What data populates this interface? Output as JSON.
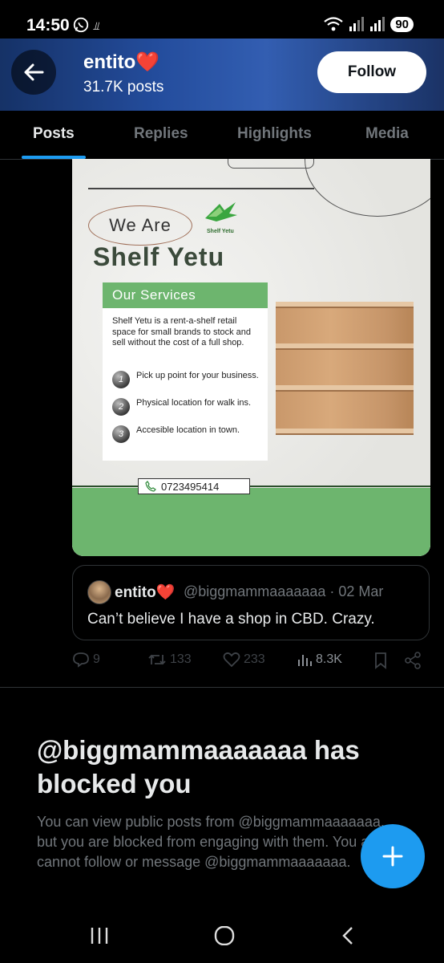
{
  "status_bar": {
    "time": "14:50",
    "vibrate_glyph": "⫫",
    "battery": "90",
    "icons": [
      "whatsapp-icon",
      "vibrate-icon",
      "wifi-icon",
      "signal-icon",
      "signal-icon-2",
      "battery-icon"
    ]
  },
  "header": {
    "title": "entito",
    "title_emoji": "❤️",
    "subtitle": "31.7K posts",
    "follow_label": "Follow",
    "back_icon": "arrow-left-icon"
  },
  "tabs": [
    {
      "label": "Posts",
      "active": true
    },
    {
      "label": "Replies",
      "active": false
    },
    {
      "label": "Highlights",
      "active": false
    },
    {
      "label": "Media",
      "active": false
    }
  ],
  "post_image": {
    "we_are": "We Are",
    "brand": "Shelf Yetu",
    "logo_text": "Shelf Yetu",
    "services_heading": "Our Services",
    "services_desc": "Shelf Yetu is a rent-a-shelf retail space for small brands to stock and sell without the cost of a full shop.",
    "services": [
      {
        "num": "1",
        "text": "Pick up point for your business."
      },
      {
        "num": "2",
        "text": "Physical location for walk ins."
      },
      {
        "num": "3",
        "text": "Accesible location in town."
      }
    ],
    "phone": "0723495414"
  },
  "quote": {
    "name": "entito",
    "name_emoji": "❤️",
    "handle_date": "@biggmammaaaaaaa · 02 Mar",
    "text": "Can’t believe I have a shop in CBD. Crazy."
  },
  "actions": {
    "replies": "9",
    "reposts": "133",
    "likes": "233",
    "views": "8.3K"
  },
  "blocked": {
    "title": "@biggmammaaaaaaa has blocked you",
    "desc": "You can view public posts from @biggmammaaaaaaa, but you are blocked from engaging with them. You also cannot follow or message @biggmammaaaaaaa."
  },
  "fab_icon": "plus-icon",
  "nav": [
    "recents-icon",
    "home-icon",
    "back-icon"
  ]
}
